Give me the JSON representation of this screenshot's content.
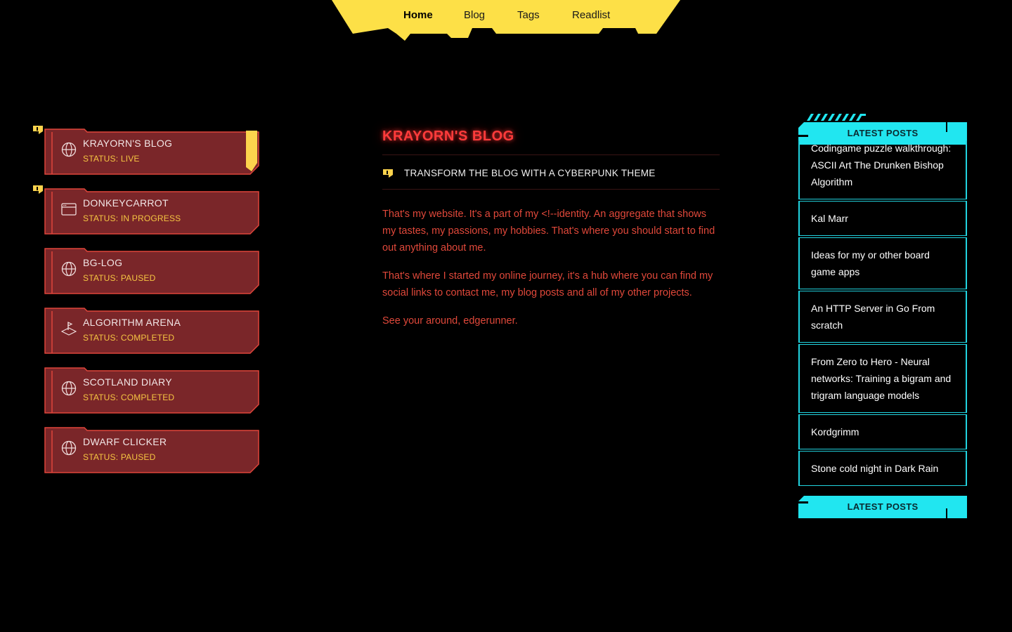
{
  "nav": {
    "items": [
      {
        "label": "Home",
        "active": true
      },
      {
        "label": "Blog",
        "active": false
      },
      {
        "label": "Tags",
        "active": false
      },
      {
        "label": "Readlist",
        "active": false
      }
    ]
  },
  "projects": [
    {
      "name": "KRAYORN'S BLOG",
      "status": "STATUS: LIVE",
      "icon": "globe-icon",
      "flagged": true,
      "selected": true
    },
    {
      "name": "DONKEYCARROT",
      "status": "STATUS: IN PROGRESS",
      "icon": "browser-window-icon",
      "flagged": true,
      "selected": false
    },
    {
      "name": "BG-LOG",
      "status": "STATUS: PAUSED",
      "icon": "globe-icon",
      "flagged": false,
      "selected": false
    },
    {
      "name": "ALGORITHM ARENA",
      "status": "STATUS: COMPLETED",
      "icon": "flag-on-platform-icon",
      "flagged": false,
      "selected": false
    },
    {
      "name": "SCOTLAND DIARY",
      "status": "STATUS: COMPLETED",
      "icon": "globe-icon",
      "flagged": false,
      "selected": false
    },
    {
      "name": "DWARF CLICKER",
      "status": "STATUS: PAUSED",
      "icon": "globe-icon",
      "flagged": false,
      "selected": false
    }
  ],
  "main": {
    "title": "KRAYORN'S BLOG",
    "quest": "TRANSFORM THE BLOG WITH A CYBERPUNK THEME",
    "paragraphs": [
      "That's my website. It's a part of my <!--identity. An aggregate that shows my tastes, my passions, my hobbies. That's where you should start to find out anything about me.",
      "That's where I started my online journey, it's a hub where you can find my social links to contact me, my blog posts and all of my other projects.",
      "See your around, edgerunner."
    ]
  },
  "latest_posts": {
    "header": "LATEST POSTS",
    "footer": "LATEST POSTS",
    "items": [
      "Codingame puzzle walkthrough: ASCII Art The Drunken Bishop Algorithm",
      "Kal Marr",
      "Ideas for my or other board game apps",
      "An HTTP Server in Go From scratch",
      "From Zero to Hero - Neural networks: Training a bigram and trigram language models",
      "Kordgrimm",
      "Stone cold night in Dark Rain"
    ]
  },
  "colors": {
    "nav_yellow": "#fde047",
    "card_fill": "#7a2629",
    "card_border": "#e0453a",
    "status_yellow": "#f5c542",
    "title_red": "#ff3b3b",
    "text_red": "#e0483a",
    "cyan": "#21e6f0"
  }
}
